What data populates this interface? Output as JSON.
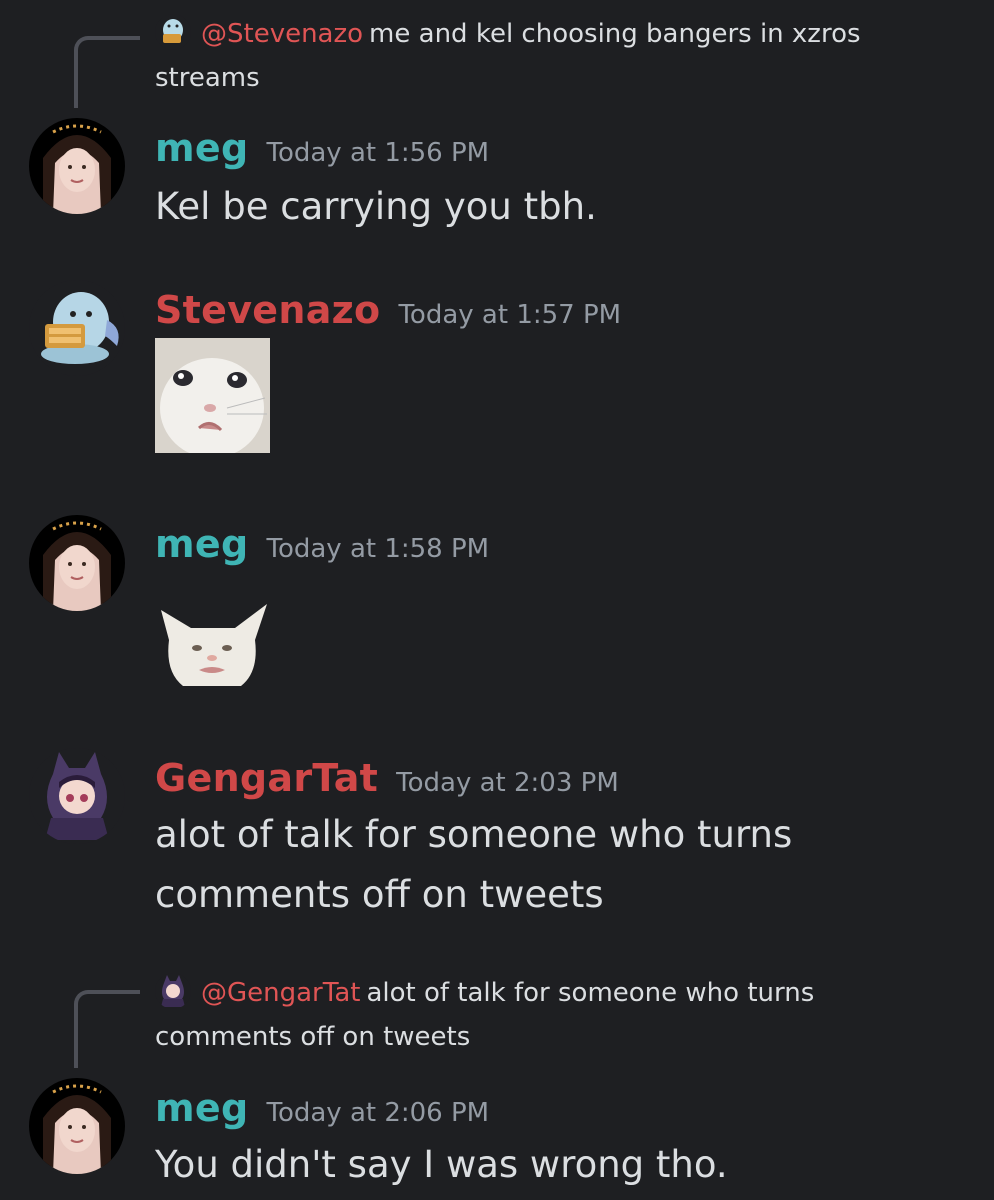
{
  "messages": [
    {
      "reply": {
        "mention": "@Stevenazo",
        "text": "me and kel choosing bangers in xzros",
        "text_cont": "streams",
        "avatar_icon": "stevenazo-avatar-icon"
      },
      "author": "meg",
      "timestamp": "Today at 1:56 PM",
      "text": "Kel be carrying you tbh."
    },
    {
      "author": "Stevenazo",
      "timestamp": "Today at 1:57 PM",
      "attachment": "crying-cat-image"
    },
    {
      "author": "meg",
      "timestamp": "Today at 1:58 PM",
      "attachment": "smudge-cat-image"
    },
    {
      "author": "GengarTat",
      "timestamp": "Today at 2:03 PM",
      "text_line1": "alot of talk for someone who turns",
      "text_line2": "comments off on tweets"
    },
    {
      "reply": {
        "mention": "@GengarTat",
        "text": "alot of talk for someone who turns",
        "text_cont": "comments off on tweets",
        "avatar_icon": "gengartat-avatar-icon"
      },
      "author": "meg",
      "timestamp": "Today at 2:06 PM",
      "text": "You didn't say I was wrong tho."
    }
  ],
  "colors": {
    "background": "#1e1f22",
    "meg_name": "#3fb5b5",
    "red_name": "#d04848",
    "mention": "#e05555",
    "timestamp": "#949ba4",
    "text": "#dbdee1"
  }
}
